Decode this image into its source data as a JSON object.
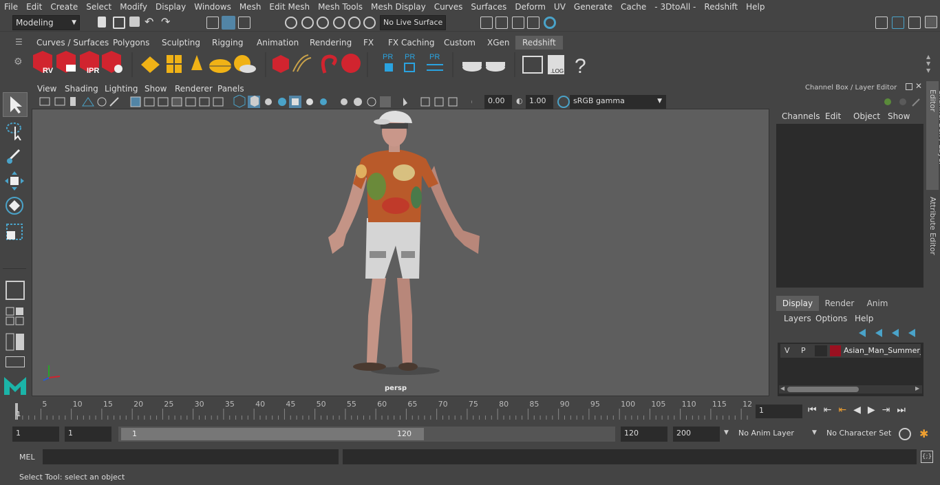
{
  "menubar": [
    "File",
    "Edit",
    "Create",
    "Select",
    "Modify",
    "Display",
    "Windows",
    "Mesh",
    "Edit Mesh",
    "Mesh Tools",
    "Mesh Display",
    "Curves",
    "Surfaces",
    "Deform",
    "UV",
    "Generate",
    "Cache",
    "- 3DtoAll -",
    "Redshift",
    "Help"
  ],
  "status": {
    "mode": "Modeling",
    "live_surface": "No Live Surface"
  },
  "shelf_tabs": [
    "Curves / Surfaces",
    "Polygons",
    "Sculpting",
    "Rigging",
    "Animation",
    "Rendering",
    "FX",
    "FX Caching",
    "Custom",
    "XGen",
    "Redshift"
  ],
  "active_shelf_tab": "Redshift",
  "shelf_labels": {
    "rv": "RV",
    "ipr": "IPR",
    "pr1": "PR",
    "pr2": "PR",
    "pr3": "PR",
    "log": ".LOG",
    "help": "?"
  },
  "viewport": {
    "menu": [
      "View",
      "Shading",
      "Lighting",
      "Show",
      "Renderer",
      "Panels"
    ],
    "exposure": "0.00",
    "gamma": "1.00",
    "color_space": "sRGB gamma",
    "camera": "persp"
  },
  "channel_box": {
    "title": "Channel Box / Layer Editor",
    "menu": [
      "Channels",
      "Edit",
      "Object",
      "Show"
    ],
    "side_tab_1": "Channel Box / Layer Editor",
    "side_tab_2": "Attribute Editor"
  },
  "layer_editor": {
    "tabs": [
      "Display",
      "Render",
      "Anim"
    ],
    "active_tab": "Display",
    "menu": [
      "Layers",
      "Options",
      "Help"
    ],
    "layer": {
      "v": "V",
      "p": "P",
      "name": "Asian_Man_Summer_C",
      "color": "#9b1020"
    }
  },
  "timeline": {
    "ticks": [
      "5",
      "10",
      "15",
      "20",
      "25",
      "30",
      "35",
      "40",
      "45",
      "50",
      "55",
      "60",
      "65",
      "70",
      "75",
      "80",
      "85",
      "90",
      "95",
      "100",
      "105",
      "110",
      "115",
      "12"
    ],
    "first": "1",
    "current_frame": "1"
  },
  "range": {
    "start": "1",
    "start2": "1",
    "slider_start": "1",
    "slider_end": "120",
    "end": "120",
    "end2": "200",
    "anim_layer": "No Anim Layer",
    "char_set": "No Character Set"
  },
  "cmd": {
    "lang": "MEL"
  },
  "help_line": "Select Tool: select an object",
  "colors": {
    "accent": "#5285a6",
    "highlight": "#2b2b2b",
    "redshift": "#d1242f",
    "gold": "#f0b216"
  }
}
